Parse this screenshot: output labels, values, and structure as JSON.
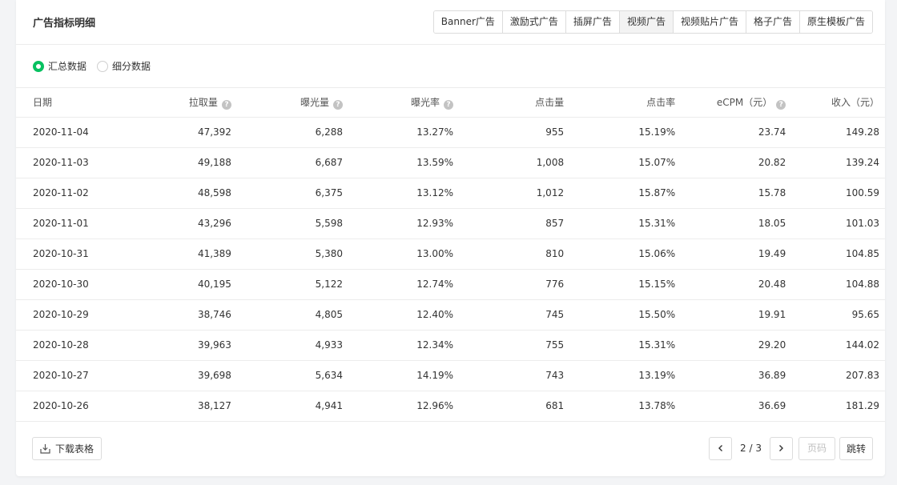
{
  "title": "广告指标明细",
  "tabs": [
    "Banner广告",
    "激励式广告",
    "插屏广告",
    "视频广告",
    "视频贴片广告",
    "格子广告",
    "原生模板广告"
  ],
  "active_tab": "视频广告",
  "radios": [
    {
      "label": "汇总数据",
      "checked": true
    },
    {
      "label": "细分数据",
      "checked": false
    }
  ],
  "columns": [
    "日期",
    "拉取量",
    "曝光量",
    "曝光率",
    "点击量",
    "点击率",
    "eCPM（元）",
    "收入（元）"
  ],
  "rows": [
    [
      "2020-11-04",
      "47,392",
      "6,288",
      "13.27%",
      "955",
      "15.19%",
      "23.74",
      "149.28"
    ],
    [
      "2020-11-03",
      "49,188",
      "6,687",
      "13.59%",
      "1,008",
      "15.07%",
      "20.82",
      "139.24"
    ],
    [
      "2020-11-02",
      "48,598",
      "6,375",
      "13.12%",
      "1,012",
      "15.87%",
      "15.78",
      "100.59"
    ],
    [
      "2020-11-01",
      "43,296",
      "5,598",
      "12.93%",
      "857",
      "15.31%",
      "18.05",
      "101.03"
    ],
    [
      "2020-10-31",
      "41,389",
      "5,380",
      "13.00%",
      "810",
      "15.06%",
      "19.49",
      "104.85"
    ],
    [
      "2020-10-30",
      "40,195",
      "5,122",
      "12.74%",
      "776",
      "15.15%",
      "20.48",
      "104.88"
    ],
    [
      "2020-10-29",
      "38,746",
      "4,805",
      "12.40%",
      "745",
      "15.50%",
      "19.91",
      "95.65"
    ],
    [
      "2020-10-28",
      "39,963",
      "4,933",
      "12.34%",
      "755",
      "15.31%",
      "29.20",
      "144.02"
    ],
    [
      "2020-10-27",
      "39,698",
      "5,634",
      "14.19%",
      "743",
      "13.19%",
      "36.89",
      "207.83"
    ],
    [
      "2020-10-26",
      "38,127",
      "4,941",
      "12.96%",
      "681",
      "13.78%",
      "36.69",
      "181.29"
    ]
  ],
  "footer": {
    "download_label": "下载表格",
    "page_info": "2 / 3",
    "page_placeholder": "页码",
    "jump_label": "跳转"
  },
  "colors": {
    "accent": "#07c160"
  }
}
